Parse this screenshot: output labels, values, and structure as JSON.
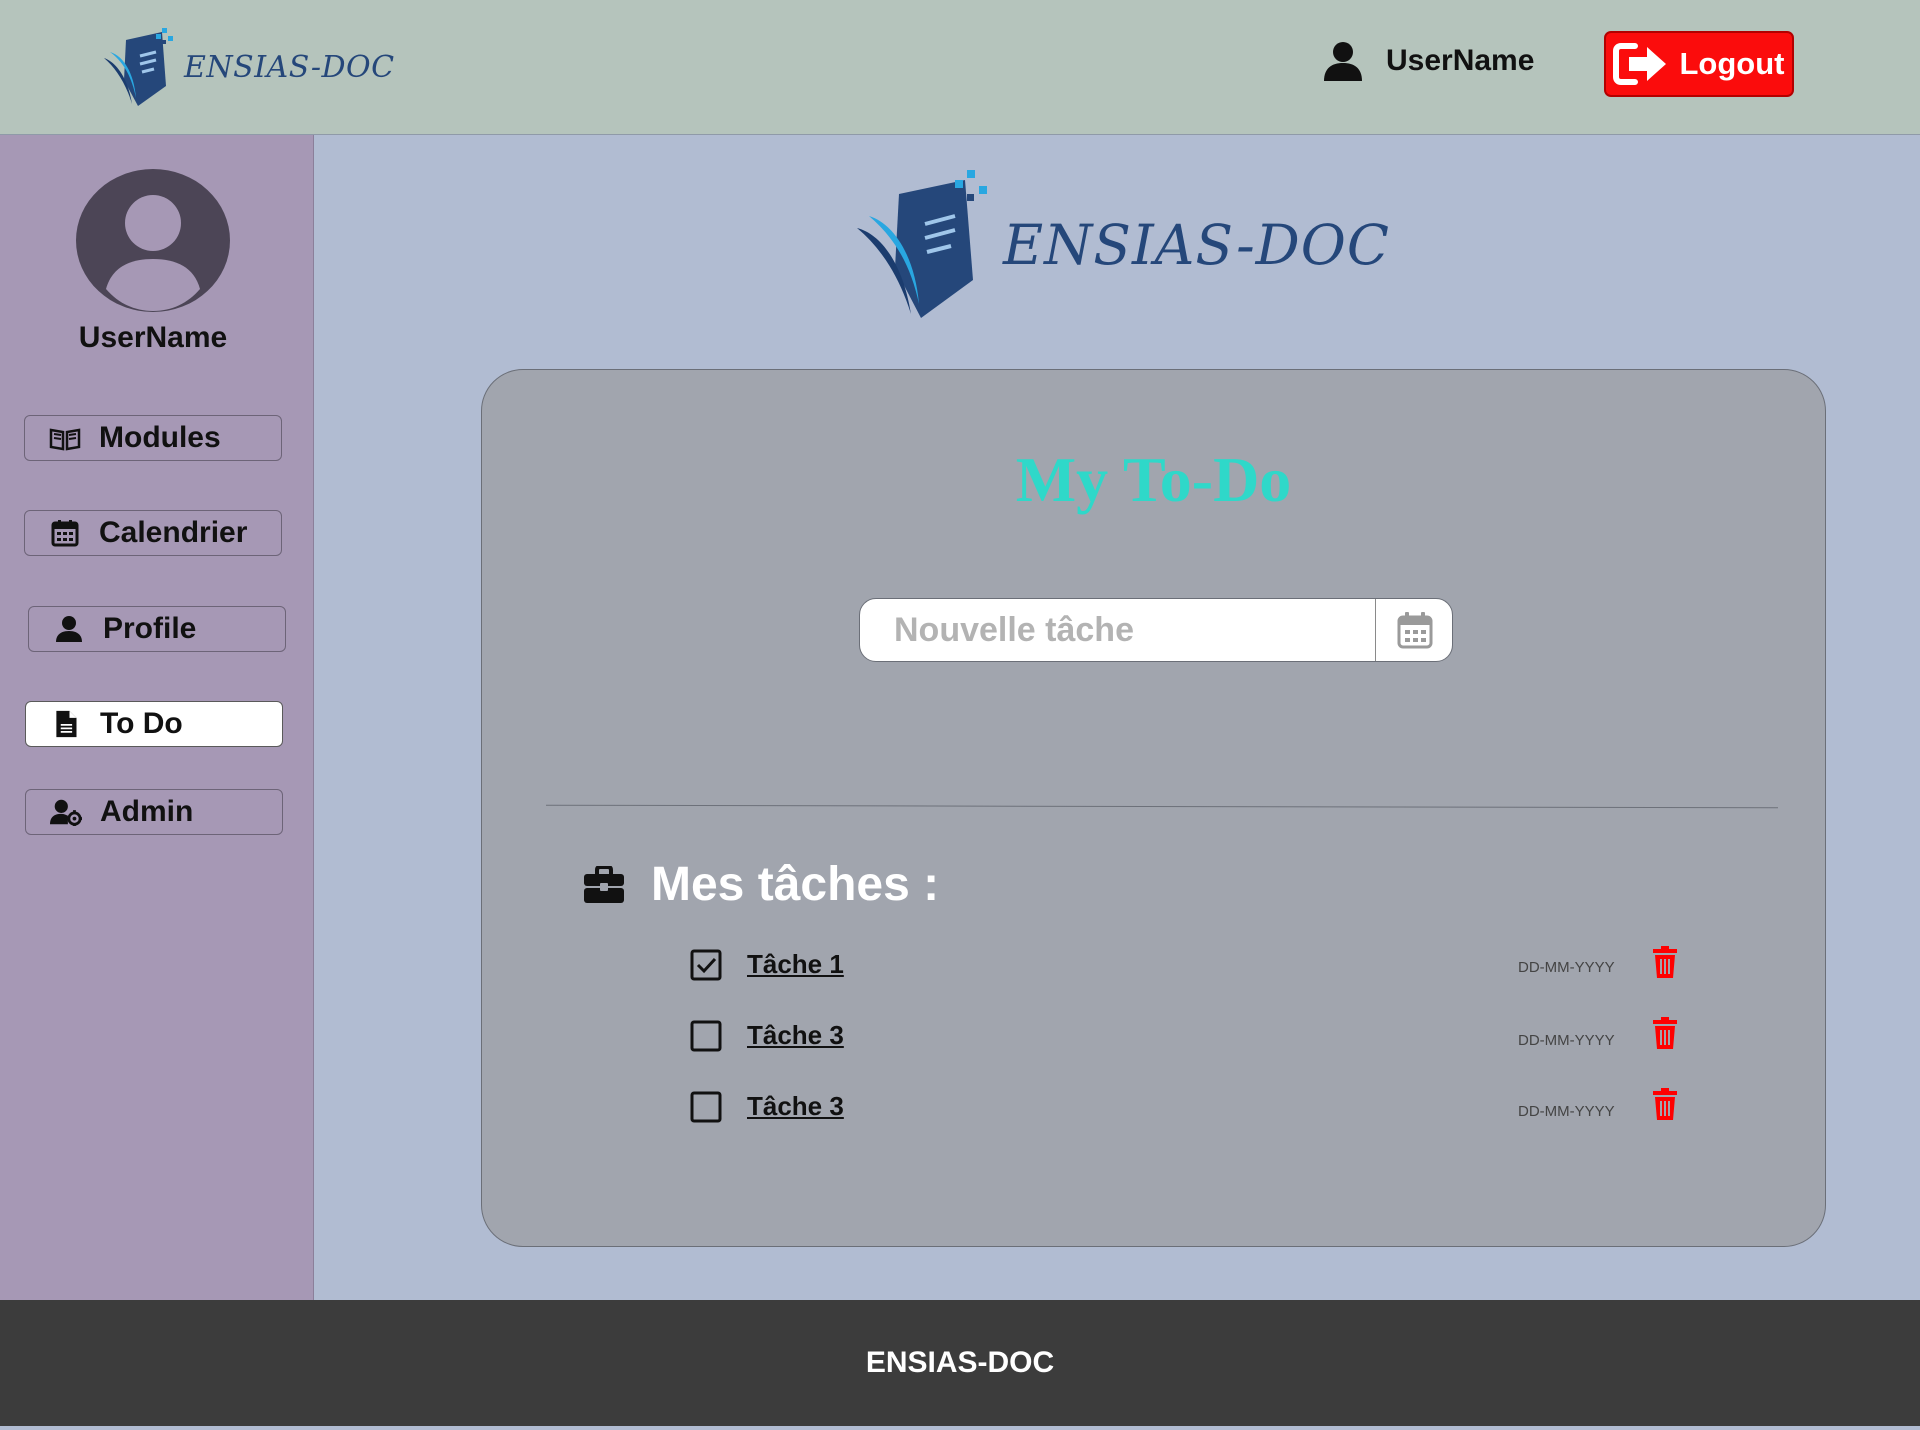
{
  "header": {
    "brand": "ENSIAS-DOC",
    "username": "UserName",
    "logout_label": "Logout"
  },
  "sidebar": {
    "username": "UserName",
    "items": [
      {
        "label": "Modules",
        "icon": "book-open-icon"
      },
      {
        "label": "Calendrier",
        "icon": "calendar-icon"
      },
      {
        "label": "Profile",
        "icon": "user-icon"
      },
      {
        "label": "To Do",
        "icon": "file-icon",
        "active": true
      },
      {
        "label": "Admin",
        "icon": "user-gear-icon"
      }
    ]
  },
  "main": {
    "brand": "ENSIAS-DOC",
    "title": "My To-Do",
    "new_task_placeholder": "Nouvelle tâche",
    "tasks_header": "Mes tâches :",
    "tasks": [
      {
        "label": "Tâche 1",
        "date": "DD-MM-YYYY",
        "checked": true
      },
      {
        "label": "Tâche 3",
        "date": "DD-MM-YYYY",
        "checked": false
      },
      {
        "label": "Tâche 3",
        "date": "DD-MM-YYYY",
        "checked": false
      }
    ]
  },
  "footer": {
    "text": "ENSIAS-DOC"
  },
  "colors": {
    "header_bg": "#b5c4bc",
    "sidebar_bg": "#a698b5",
    "main_bg": "#b1bcd2",
    "card_bg": "#a1a5ae",
    "title_color": "#2fd8c9",
    "logout_bg": "#fb0c0c",
    "delete_icon": "#ff0000",
    "footer_bg": "#3c3c3c",
    "brand_blue": "#25477a"
  }
}
